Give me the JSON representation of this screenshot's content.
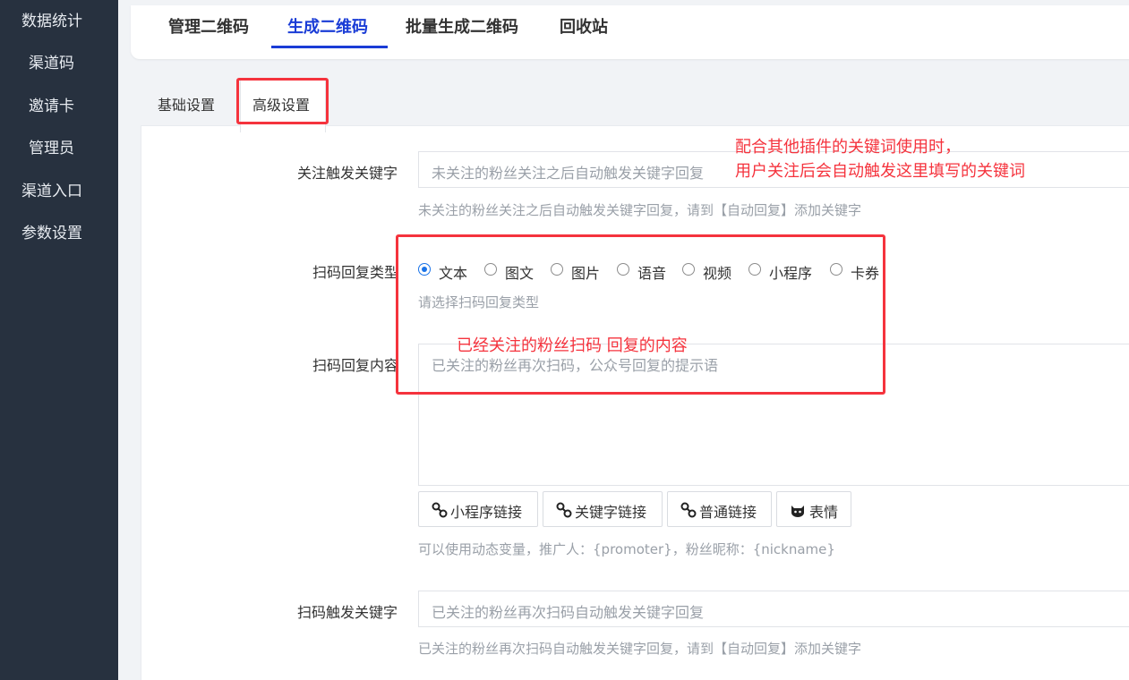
{
  "sidebar": {
    "items": [
      {
        "label": "数据统计"
      },
      {
        "label": "渠道码"
      },
      {
        "label": "邀请卡"
      },
      {
        "label": "管理员"
      },
      {
        "label": "渠道入口"
      },
      {
        "label": "参数设置"
      }
    ]
  },
  "top_tabs": [
    {
      "label": "管理二维码"
    },
    {
      "label": "生成二维码",
      "active": true
    },
    {
      "label": "批量生成二维码"
    },
    {
      "label": "回收站"
    }
  ],
  "sub_tabs": [
    {
      "label": "基础设置"
    },
    {
      "label": "高级设置",
      "active": true
    }
  ],
  "form": {
    "follow_keyword": {
      "label": "关注触发关键字",
      "placeholder": "未关注的粉丝关注之后自动触发关键字回复",
      "help": "未关注的粉丝关注之后自动触发关键字回复，请到【自动回复】添加关键字"
    },
    "reply_type": {
      "label": "扫码回复类型",
      "options": [
        "文本",
        "图文",
        "图片",
        "语音",
        "视频",
        "小程序",
        "卡券"
      ],
      "selected": "文本",
      "help": "请选择扫码回复类型"
    },
    "reply_content": {
      "label": "扫码回复内容",
      "placeholder": "已关注的粉丝再次扫码，公众号回复的提示语",
      "buttons": [
        {
          "label": "小程序链接",
          "icon": "link-icon"
        },
        {
          "label": "关键字链接",
          "icon": "link-icon"
        },
        {
          "label": "普通链接",
          "icon": "link-icon"
        },
        {
          "label": "表情",
          "icon": "emoji-icon"
        }
      ],
      "help": "可以使用动态变量，推广人：{promoter}，粉丝昵称：{nickname}"
    },
    "scan_keyword": {
      "label": "扫码触发关键字",
      "placeholder": "已关注的粉丝再次扫码自动触发关键字回复",
      "help": "已关注的粉丝再次扫码自动触发关键字回复，请到【自动回复】添加关键字"
    }
  },
  "annotations": {
    "note1_line1": "配合其他插件的关键词使用时，",
    "note1_line2": "用户关注后会自动触发这里填写的关键词",
    "note2": "已经关注的粉丝扫码 回复的内容",
    "color": "#f5333d"
  },
  "colors": {
    "accent": "#1a3cd6",
    "sidebar_bg": "#27313f",
    "annotation": "#f5333d"
  }
}
